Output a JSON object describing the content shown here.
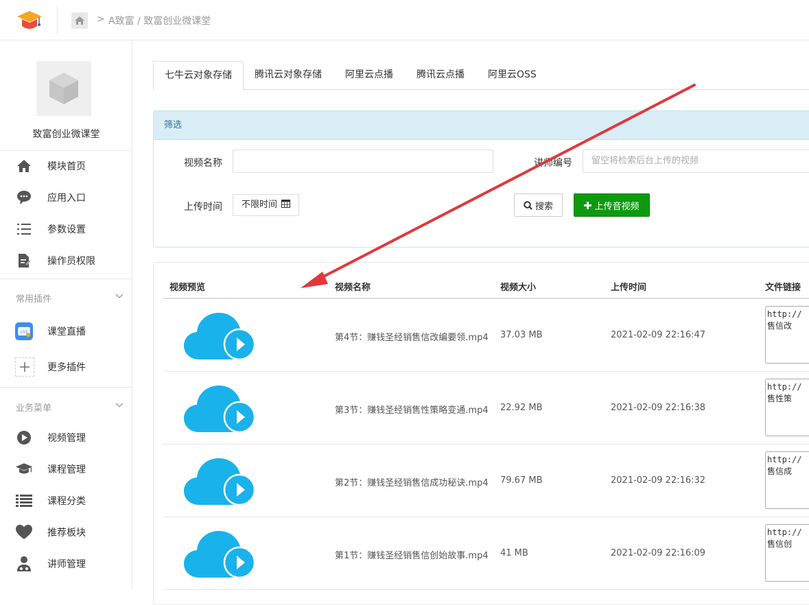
{
  "header": {
    "breadcrumb_separator": ">",
    "breadcrumb_text": "A致富 / 致富创业微课堂"
  },
  "sidebar": {
    "app_name": "致富创业微课堂",
    "main_items": [
      {
        "label": "模块首页",
        "icon": "home-icon"
      },
      {
        "label": "应用入口",
        "icon": "chat-bubble-icon"
      },
      {
        "label": "参数设置",
        "icon": "list-settings-icon"
      },
      {
        "label": "操作员权限",
        "icon": "document-edit-icon"
      }
    ],
    "group_plugins": {
      "label": "常用插件",
      "items": [
        {
          "label": "课堂直播",
          "icon": "live-tv-icon"
        },
        {
          "label": "更多插件",
          "icon": "plus-icon"
        }
      ]
    },
    "group_business": {
      "label": "业务菜单",
      "items": [
        {
          "label": "视频管理",
          "icon": "play-circle-icon"
        },
        {
          "label": "课程管理",
          "icon": "graduation-cap-icon"
        },
        {
          "label": "课程分类",
          "icon": "list-icon"
        },
        {
          "label": "推荐板块",
          "icon": "heart-icon"
        },
        {
          "label": "讲师管理",
          "icon": "user-doctor-icon"
        }
      ]
    }
  },
  "tabs": [
    {
      "label": "七牛云对象存储",
      "active": true
    },
    {
      "label": "腾讯云对象存储",
      "active": false
    },
    {
      "label": "阿里云点播",
      "active": false
    },
    {
      "label": "腾讯云点播",
      "active": false
    },
    {
      "label": "阿里云OSS",
      "active": false
    }
  ],
  "filter": {
    "title": "筛选",
    "video_name_label": "视频名称",
    "video_name_value": "",
    "teacher_label": "讲师编号",
    "teacher_placeholder": "留空将检索后台上传的视频",
    "upload_time_label": "上传时间",
    "upload_time_value": "不限时间",
    "search_button": "搜索",
    "upload_button": "上传音视频"
  },
  "table": {
    "columns": [
      "视频预览",
      "视频名称",
      "视频大小",
      "上传时间",
      "文件链接"
    ],
    "rows": [
      {
        "name": "第4节：赚钱圣经销售信改编要领.mp4",
        "size": "37.03 MB",
        "time": "2021-02-09 22:16:47",
        "link": "http://\n售信改"
      },
      {
        "name": "第3节：赚钱圣经销售性策略变通.mp4",
        "size": "22.92 MB",
        "time": "2021-02-09 22:16:38",
        "link": "http://\n售性策"
      },
      {
        "name": "第2节：赚钱圣经销售信成功秘诀.mp4",
        "size": "79.67 MB",
        "time": "2021-02-09 22:16:32",
        "link": "http://\n售信成"
      },
      {
        "name": "第1节：赚钱圣经销售信创始故事.mp4",
        "size": "41 MB",
        "time": "2021-02-09 22:16:09",
        "link": "http://\n售信创"
      }
    ]
  },
  "colors": {
    "accent_green": "#0e9a0e",
    "cloud_blue": "#1ab2ea",
    "annotation_red": "#e0393b",
    "filter_header_bg": "#d9edf7"
  }
}
